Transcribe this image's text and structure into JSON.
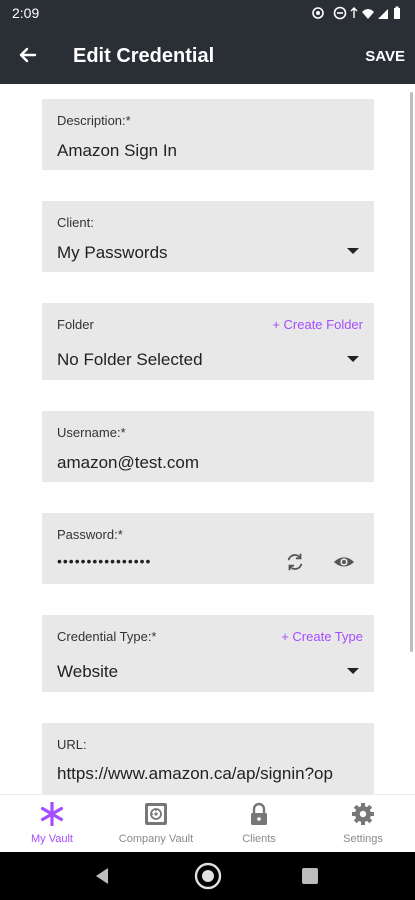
{
  "status_bar": {
    "time": "2:09"
  },
  "app_bar": {
    "title": "Edit Credential",
    "save_label": "SAVE"
  },
  "form": {
    "description": {
      "label": "Description:*",
      "value": "Amazon Sign In"
    },
    "client": {
      "label": "Client:",
      "value": "My Passwords"
    },
    "folder": {
      "label": "Folder",
      "value": "No Folder Selected",
      "action": "+ Create Folder"
    },
    "username": {
      "label": "Username:*",
      "value": "amazon@test.com"
    },
    "password": {
      "label": "Password:*",
      "value": "••••••••••••••••"
    },
    "credential_type": {
      "label": "Credential Type:*",
      "value": "Website",
      "action": "+ Create Type"
    },
    "url": {
      "label": "URL:",
      "value": "https://www.amazon.ca/ap/signin?op"
    }
  },
  "bottom_nav": {
    "items": [
      {
        "label": "My Vault",
        "icon": "asterisk-icon",
        "active": true
      },
      {
        "label": "Company Vault",
        "icon": "safe-icon",
        "active": false
      },
      {
        "label": "Clients",
        "icon": "lock-icon",
        "active": false
      },
      {
        "label": "Settings",
        "icon": "gear-icon",
        "active": false
      }
    ]
  },
  "colors": {
    "accent": "#a64dff",
    "app_bar": "#2a2f36",
    "field_bg": "#e8e8e8"
  }
}
